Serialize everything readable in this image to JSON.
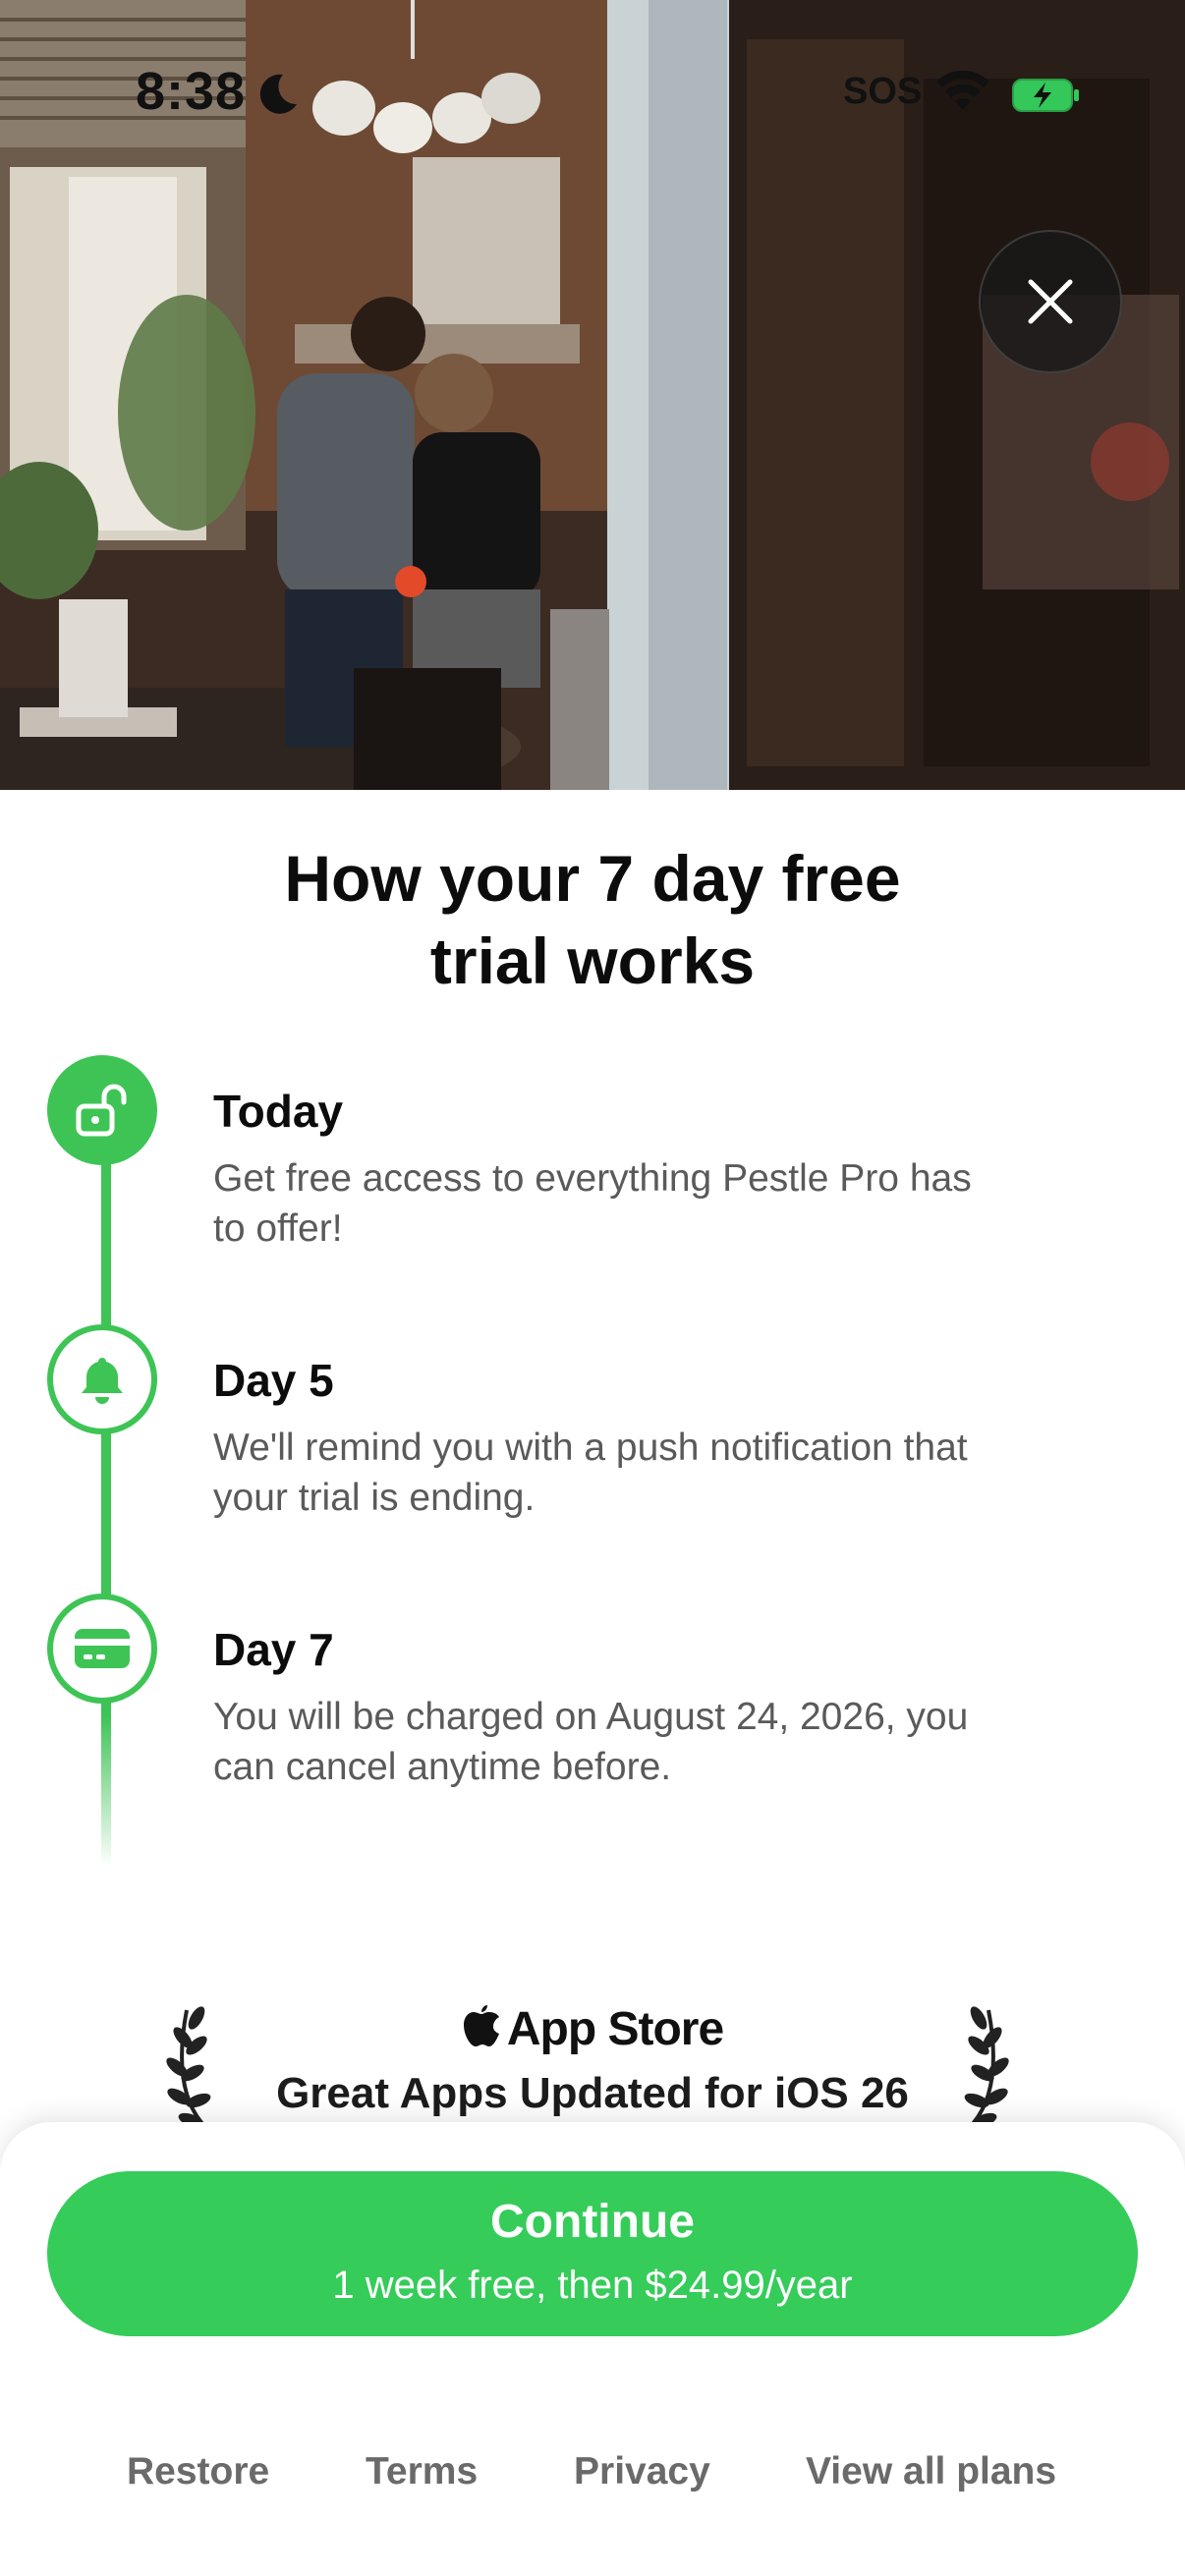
{
  "status_bar": {
    "time": "8:38",
    "carrier_status": "SOS"
  },
  "icons": {
    "close": "close-icon",
    "step1": "unlock-icon",
    "step2": "bell-icon",
    "step3": "credit-card-icon",
    "award_logo": "apple-logo-icon",
    "laurel": "laurel-icon"
  },
  "headline": {
    "line1": "How your 7 day free",
    "line2": "trial works"
  },
  "timeline": [
    {
      "title": "Today",
      "desc_line1": "Get free access to everything Pestle Pro has",
      "desc_line2": "to offer!"
    },
    {
      "title": "Day 5",
      "desc_line1": "We'll remind you with a push notification that",
      "desc_line2": "your trial is ending."
    },
    {
      "title": "Day 7",
      "desc_line1": "You will be charged on August 24, 2026, you",
      "desc_line2": "can cancel anytime before."
    }
  ],
  "award": {
    "store": "App Store",
    "subtitle": "Great Apps Updated for iOS 26"
  },
  "cta": {
    "label": "Continue",
    "sublabel": "1 week free, then $24.99/year"
  },
  "footer_links": [
    "Restore",
    "Terms",
    "Privacy",
    "View all plans"
  ],
  "colors": {
    "accent": "#35cc5a",
    "timeline": "#3ec455",
    "battery_charging": "#34c759"
  }
}
